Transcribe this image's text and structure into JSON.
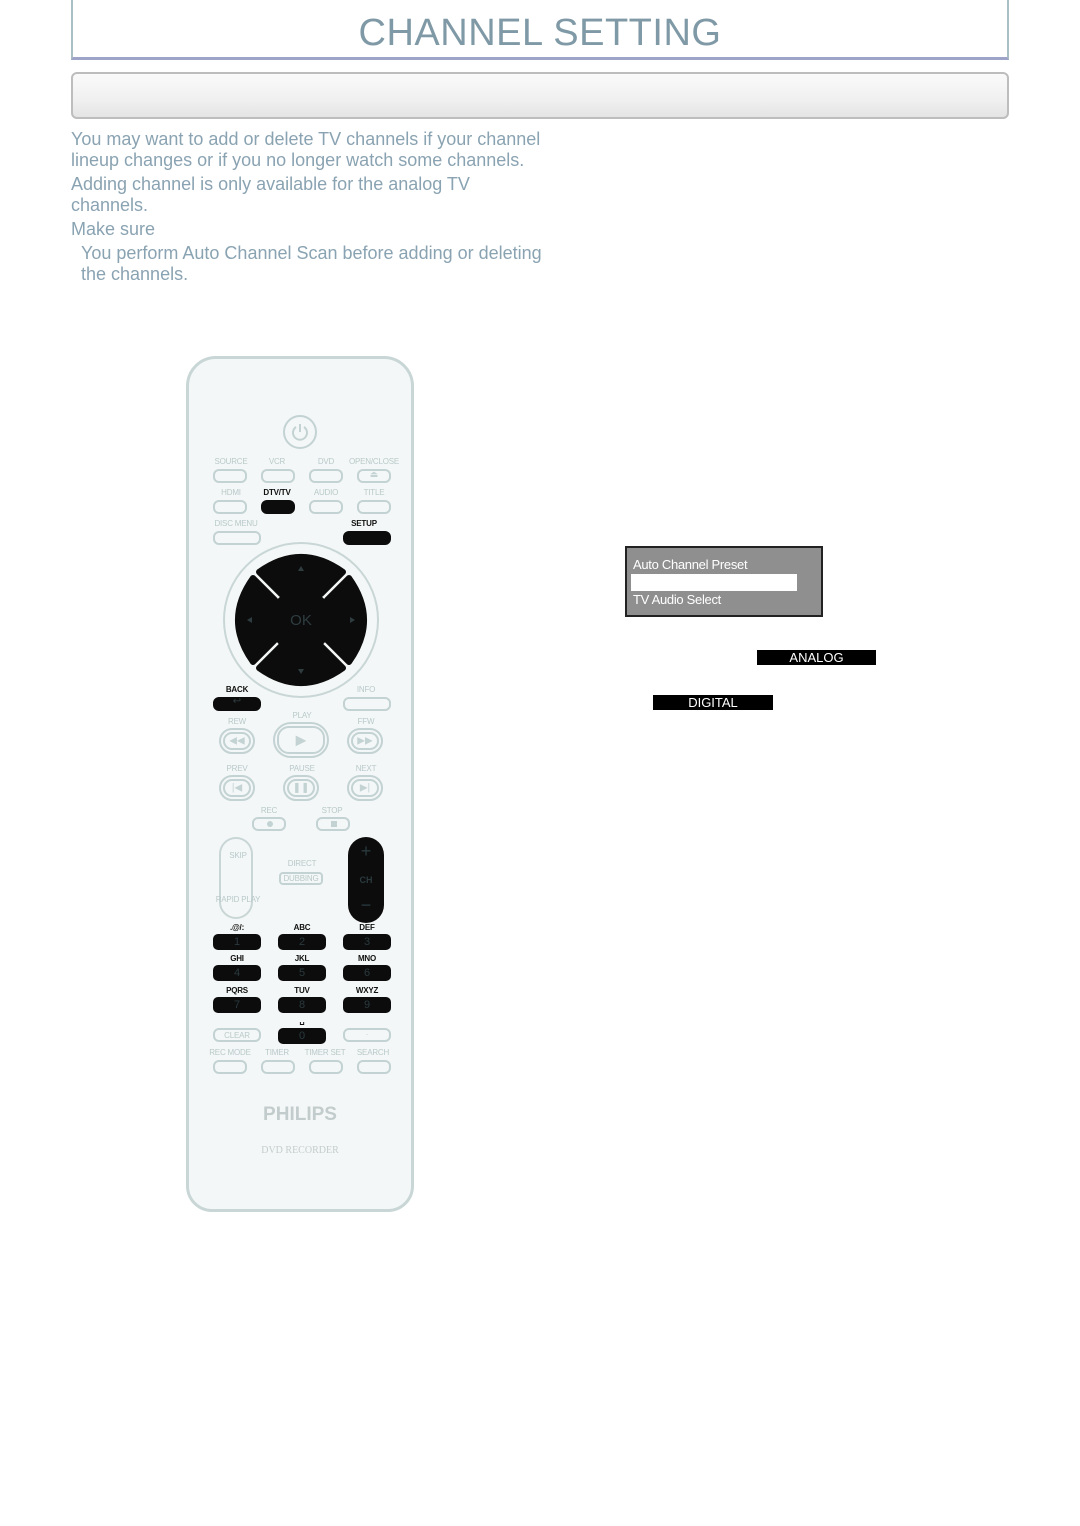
{
  "header": {
    "title": "CHANNEL SETTING",
    "subtitle": ""
  },
  "intro": {
    "paragraph1": "You may want to add or delete TV channels if your channel lineup changes or if you no longer watch some channels.",
    "paragraph2": "Adding channel is only available for the analog TV channels.",
    "make_sure_label": "Make sure",
    "make_sure_item": "You perform  Auto Channel Scan  before adding or deleting the channels."
  },
  "remote": {
    "brand": "PHILIPS",
    "model": "DVD RECORDER",
    "row1_labels": [
      "SOURCE",
      "VCR",
      "DVD",
      "OPEN/CLOSE"
    ],
    "row2_labels": [
      "HDMI",
      "DTV/TV",
      "AUDIO",
      "TITLE"
    ],
    "disc_menu": "DISC MENU",
    "setup": "SETUP",
    "ok": "OK",
    "back": "BACK",
    "info": "INFO",
    "play": "PLAY",
    "rew": "REW",
    "ffw": "FFW",
    "prev": "PREV",
    "pause": "PAUSE",
    "next": "NEXT",
    "rec": "REC",
    "stop": "STOP",
    "skip": "SKIP",
    "rapid_play": "RAPID PLAY",
    "direct": "DIRECT",
    "dubbing": "DUBBING",
    "ch": "CH",
    "ch_plus": "+",
    "ch_minus": "−",
    "keypad": [
      {
        "letters": ".@/:",
        "digit": "1"
      },
      {
        "letters": "ABC",
        "digit": "2"
      },
      {
        "letters": "DEF",
        "digit": "3"
      },
      {
        "letters": "GHI",
        "digit": "4"
      },
      {
        "letters": "JKL",
        "digit": "5"
      },
      {
        "letters": "MNO",
        "digit": "6"
      },
      {
        "letters": "PQRS",
        "digit": "7"
      },
      {
        "letters": "TUV",
        "digit": "8"
      },
      {
        "letters": "WXYZ",
        "digit": "9"
      }
    ],
    "clear": "CLEAR",
    "zero": "0",
    "space_symbol": "␣",
    "dot": "·",
    "bottom_labels": [
      "REC MODE",
      "TIMER",
      "TIMER SET",
      "SEARCH"
    ]
  },
  "menu": {
    "items": [
      "Auto Channel Preset",
      "",
      "TV Audio Select"
    ],
    "selected_index": 1
  },
  "tags": {
    "analog": "ANALOG",
    "digital": "DIGITAL"
  },
  "colors": {
    "title": "#7f9aa6",
    "body_text": "#8aa3b2",
    "menu_bg": "#8f8f8f",
    "tag_bg": "#000000"
  }
}
